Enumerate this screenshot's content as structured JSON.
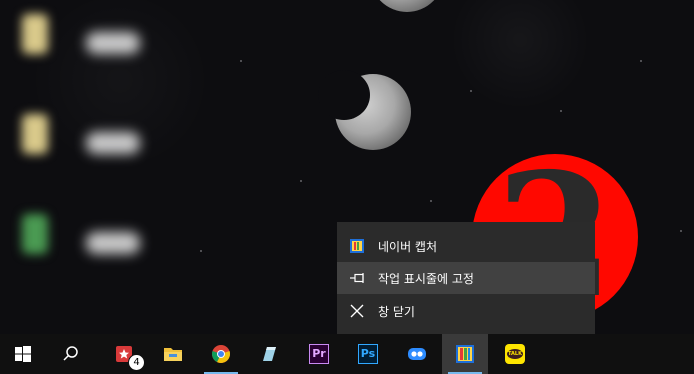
{
  "overlay": {
    "step_number": "2"
  },
  "jumplist": {
    "items": [
      {
        "label": "네이버 캡처",
        "icon": "naver-capture-icon"
      },
      {
        "label": "작업 표시줄에 고정",
        "icon": "pin-icon"
      },
      {
        "label": "창 닫기",
        "icon": "close-icon"
      }
    ]
  },
  "taskbar": {
    "app_badge_count": "4",
    "premiere_label": "Pr",
    "photoshop_label": "Ps",
    "kakaotalk_label": "TALK"
  },
  "colors": {
    "overlay_red": "#ff0800",
    "menu_bg": "#2b2b2b",
    "menu_hover": "#414141",
    "taskbar_bg": "#101010",
    "indicator_blue": "#76b9ed"
  }
}
